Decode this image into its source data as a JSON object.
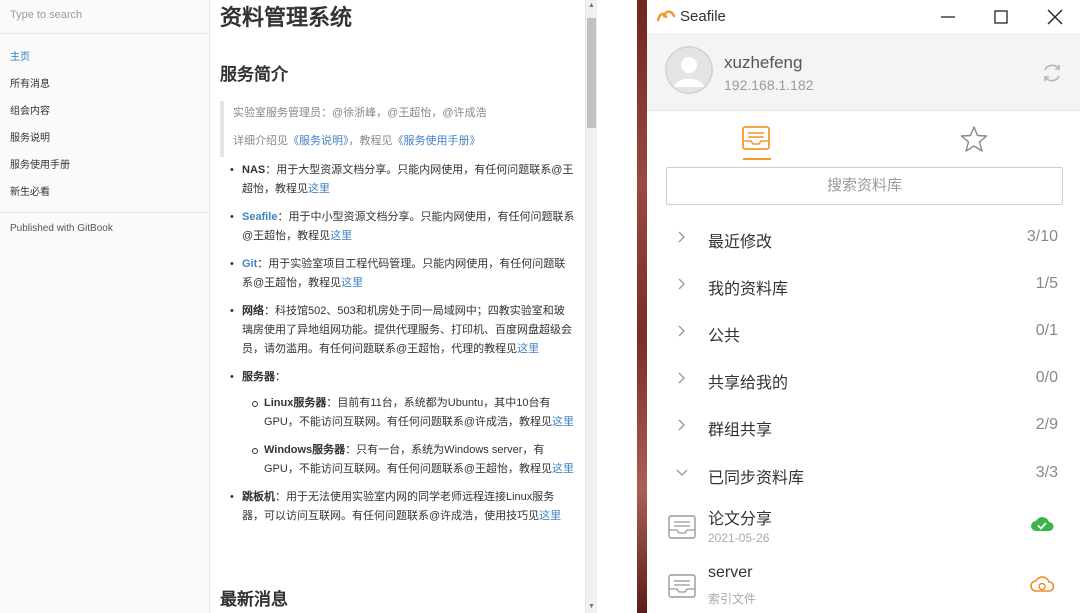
{
  "gitbook": {
    "search_placeholder": "Type to search",
    "nav": [
      "主页",
      "所有消息",
      "组会内容",
      "服务说明",
      "服务使用手册",
      "新生必看"
    ],
    "published": "Published with GitBook",
    "title": "资料管理系统",
    "section1": "服务简介",
    "quote1": "实验室服务管理员：@徐浙峰，@王超怡，@许成浩",
    "quote2_pre": "详细介绍见",
    "quote2_link1": "《服务说明》",
    "quote2_mid": "，教程见",
    "quote2_link2": "《服务使用手册》",
    "link_here": "这里",
    "items": {
      "nas_name": "NAS",
      "nas_text": "：用于大型资源文档分享。只能内网使用，有任何问题联系@王超怡，教程见",
      "seafile_name": "Seafile",
      "seafile_text": "：用于中小型资源文档分享。只能内网使用，有任何问题联系@王超怡，教程见",
      "git_name": "Git",
      "git_text": "：用于实验室项目工程代码管理。只能内网使用，有任何问题联系@王超怡，教程见",
      "network_name": "网络",
      "network_text": "：科技馆502、503和机房处于同一局域网中；四教实验室和玻璃房使用了异地组网功能。提供代理服务、打印机、百度网盘超级会员，请勿滥用。有任何问题联系@王超怡，代理的教程见",
      "servers_name": "服务器",
      "servers_colon": "：",
      "linux_name": "Linux服务器",
      "linux_text": "：目前有11台，系统都为Ubuntu，其中10台有GPU，不能访问互联网。有任何问题联系@许成浩，教程见",
      "windows_name": "Windows服务器",
      "windows_text": "：只有一台，系统为Windows server，有GPU，不能访问互联网。有任何问题联系@王超怡，教程见",
      "jump_name": "跳板机",
      "jump_text": "：用于无法使用实验室内网的同学老师远程连接Linux服务器，可以访问互联网。有任何问题联系@许成浩，使用技巧见"
    },
    "section2": "最新消息"
  },
  "seafile": {
    "app_title": "Seafile",
    "username": "xuzhefeng",
    "server": "192.168.1.182",
    "search_placeholder": "搜索资料库",
    "categories": [
      {
        "label": "最近修改",
        "count": "3/10"
      },
      {
        "label": "我的资料库",
        "count": "1/5"
      },
      {
        "label": "公共",
        "count": "0/1"
      },
      {
        "label": "共享给我的",
        "count": "0/0"
      },
      {
        "label": "群组共享",
        "count": "2/9"
      },
      {
        "label": "已同步资料库",
        "count": "3/3"
      }
    ],
    "repos": [
      {
        "name": "论文分享",
        "sub": "2021-05-26",
        "status_color": "#3bb54a"
      },
      {
        "name": "server",
        "sub": "索引文件",
        "status_color": "#f08a24"
      }
    ],
    "accent": "#f59a2e"
  }
}
